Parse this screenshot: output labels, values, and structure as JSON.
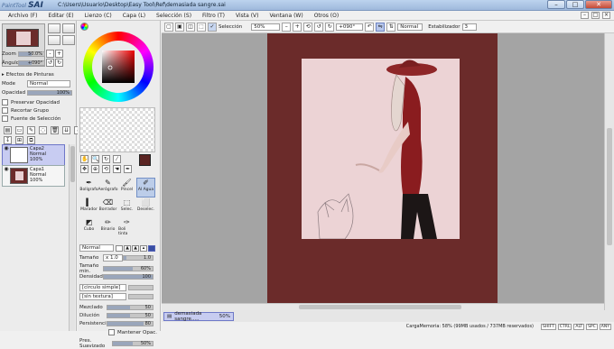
{
  "window": {
    "title": "C:\\Users\\Usuario\\Desktop\\Easy Tool\\Ref\\demasiada sangre.sai",
    "app_name": "SAI",
    "app_prefix": "PaintTool"
  },
  "menu": [
    "Archivo (F)",
    "Editar (E)",
    "Lienzo (C)",
    "Capa (L)",
    "Selección (S)",
    "Filtro (T)",
    "Vista (V)",
    "Ventana (W)",
    "Otros (O)"
  ],
  "navigator": {
    "zoom_label": "Zoom",
    "zoom_value": "50.0%",
    "angle_label": "Ángulo",
    "angle_value": "+090°"
  },
  "layer_panel": {
    "effects_label": "Efectos de Pinturas",
    "mode_label": "Mode",
    "mode_value": "Normal",
    "opacity_label": "Opacidad",
    "opacity_value": "100%",
    "preserve_label": "Preservar Opacidad",
    "clip_label": "Recortar Grupo",
    "source_label": "Fuente de Selección",
    "layers": [
      {
        "name": "Capa2",
        "mode": "Normal",
        "opacity": "100%"
      },
      {
        "name": "Capa1",
        "mode": "Normal",
        "opacity": "100%"
      }
    ]
  },
  "tools": {
    "row1": [
      "Bolígrafo",
      "Aerógrafo",
      "Pincel",
      "Al Agua"
    ],
    "row2": [
      "Marador",
      "Borrador",
      "Selec.",
      "Deselec."
    ],
    "row3": [
      "Cubo",
      "Binario",
      "Boli tinta"
    ]
  },
  "brush": {
    "mode": "Normal",
    "size_label": "Tamaño",
    "size_mult": "x 1.0",
    "size_value": "1.0",
    "min_size_label": "Tamaño min.",
    "min_size_value": "60%",
    "density_label": "Densidad",
    "density_value": "100",
    "shape": "[circulo simple]",
    "texture": "[sin textura]",
    "mix_label": "Mezclado",
    "mix_value": "50",
    "dilution_label": "Dilución",
    "dilution_value": "50",
    "persistence_label": "Persistencia",
    "persistence_value": "80",
    "keep_opacity_label": "Mantener Opac.",
    "blur_label": "Pres. Suavizado",
    "blur_value": "50%"
  },
  "toolbar": {
    "selection_label": "Selección",
    "zoom_value": "50%",
    "angle_value": "+090°",
    "mode_value": "Normal",
    "stabilizer_label": "Estabilizador",
    "stabilizer_value": "3"
  },
  "document_tab": {
    "name": "demasiada sangre.....",
    "zoom": "50%"
  },
  "status": {
    "memory": "CargaMemoria: 58% (99MB usados / 737MB reservados)",
    "keys": [
      "SHIFT",
      "CTRL",
      "ALT",
      "SPC",
      "ANY"
    ]
  },
  "colors": {
    "canvas_bg": "#6b2b2a",
    "artboard": "#ecd3d5",
    "accent": "#6e78c7",
    "brush_color": "#5a2422"
  },
  "icons": [
    "color-wheel-icon",
    "hand-icon",
    "zoom-icon",
    "rotate-icon",
    "eyedropper-icon",
    "pen-icon"
  ]
}
